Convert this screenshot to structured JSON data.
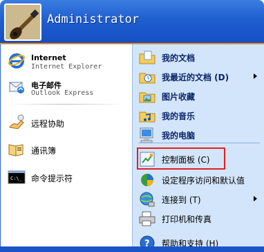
{
  "user": {
    "name": "Administrator"
  },
  "pinned": [
    {
      "name": "internet",
      "title": "Internet",
      "subtitle": "Internet Explorer",
      "icon": "internet-explorer-icon"
    },
    {
      "name": "email",
      "title": "电子邮件",
      "subtitle": "Outlook Express",
      "icon": "outlook-express-icon"
    }
  ],
  "recent": [
    {
      "name": "remote-assistance",
      "label": "远程协助",
      "icon": "remote-assistance-icon"
    },
    {
      "name": "address-book",
      "label": "通讯簿",
      "icon": "address-book-icon"
    },
    {
      "name": "command-prompt",
      "label": "命令提示符",
      "icon": "command-prompt-icon"
    }
  ],
  "places": [
    {
      "name": "my-documents",
      "label": "我的文档",
      "icon": "documents-folder-icon",
      "submenu": false
    },
    {
      "name": "my-recent-documents",
      "label": "我最近的文档 (D)",
      "icon": "recent-documents-icon",
      "submenu": true
    },
    {
      "name": "my-pictures",
      "label": "图片收藏",
      "icon": "pictures-folder-icon",
      "submenu": false
    },
    {
      "name": "my-music",
      "label": "我的音乐",
      "icon": "music-folder-icon",
      "submenu": false
    },
    {
      "name": "my-computer",
      "label": "我的电脑",
      "icon": "computer-icon",
      "submenu": false
    },
    {
      "name": "control-panel",
      "label": "控制面板 (C)",
      "icon": "control-panel-icon",
      "submenu": false
    },
    {
      "name": "set-program-defaults",
      "label": "设定程序访问和默认值",
      "icon": "program-defaults-icon",
      "submenu": false
    },
    {
      "name": "connect-to",
      "label": "连接到 (T)",
      "icon": "network-connect-icon",
      "submenu": true
    },
    {
      "name": "printers-faxes",
      "label": "打印机和传真",
      "icon": "printer-icon",
      "submenu": false
    },
    {
      "name": "help-support",
      "label": "帮助和支持 (H)",
      "icon": "help-icon",
      "submenu": false
    }
  ],
  "colors": {
    "header_blue": "#1f5fd0",
    "right_panel": "#d3e5fa",
    "highlight_red": "#e02020",
    "accent_orange": "#e58a1f"
  }
}
